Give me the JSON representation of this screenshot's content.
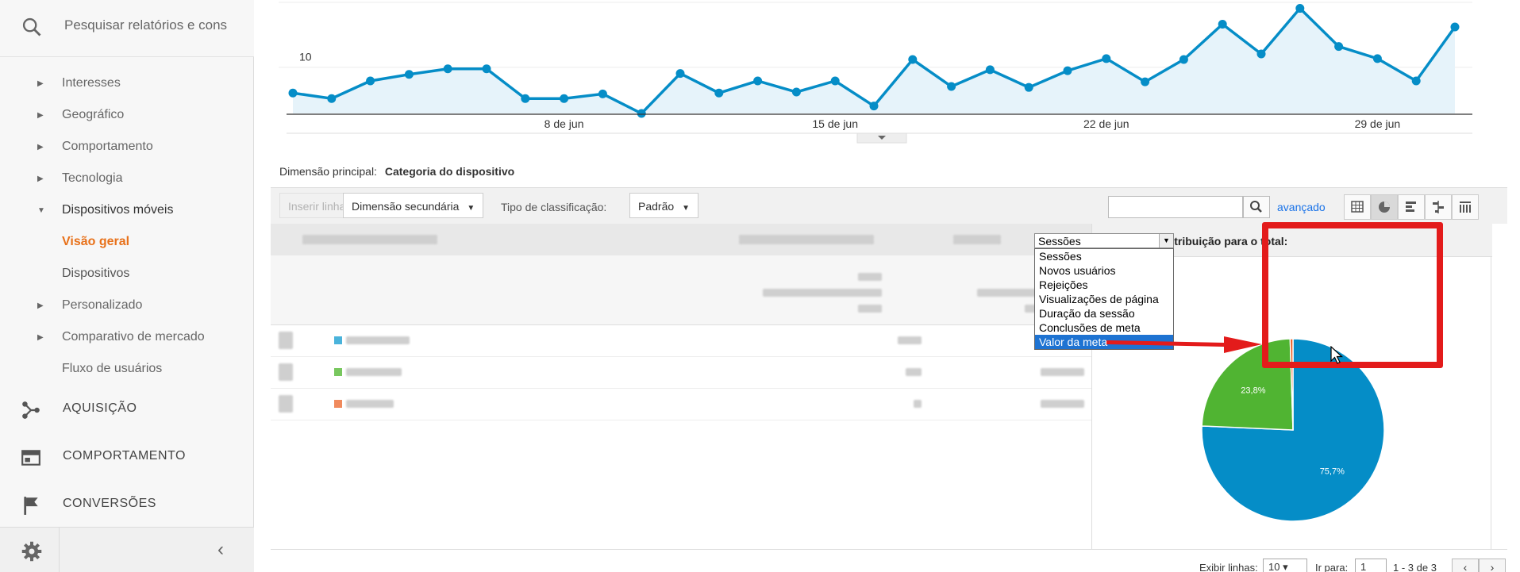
{
  "sidebar": {
    "search_placeholder": "Pesquisar relatórios e cons",
    "items": [
      {
        "label": "Interesses"
      },
      {
        "label": "Geográfico"
      },
      {
        "label": "Comportamento"
      },
      {
        "label": "Tecnologia"
      },
      {
        "label": "Dispositivos móveis"
      },
      {
        "label": "Visão geral"
      },
      {
        "label": "Dispositivos"
      },
      {
        "label": "Personalizado"
      },
      {
        "label": "Comparativo de mercado"
      },
      {
        "label": "Fluxo de usuários"
      }
    ],
    "sections": [
      {
        "label": "AQUISIÇÃO",
        "icon": "acquisition-icon"
      },
      {
        "label": "COMPORTAMENTO",
        "icon": "behavior-icon"
      },
      {
        "label": "CONVERSÕES",
        "icon": "flag-icon"
      }
    ]
  },
  "chart_data": {
    "type": "area",
    "y_tick": "10",
    "x_ticks": [
      "8 de jun",
      "15 de jun",
      "22 de jun",
      "29 de jun"
    ],
    "values": [
      7.2,
      6.6,
      8.5,
      9.2,
      9.8,
      9.8,
      6.6,
      6.6,
      7.1,
      5.0,
      9.3,
      7.2,
      8.5,
      7.3,
      8.5,
      5.8,
      10.8,
      7.9,
      9.7,
      7.8,
      9.6,
      10.9,
      8.4,
      10.8,
      14.6,
      11.4,
      16.3,
      12.2,
      10.9,
      8.5,
      14.3
    ],
    "ylim": [
      5.0,
      17.2
    ],
    "line_color": "#058dc7",
    "fill_color": "#e6f3fa"
  },
  "primary_dimension": {
    "label": "Dimensão principal:",
    "value": "Categoria do dispositivo"
  },
  "toolbar": {
    "insert_rows": "Inserir linhas",
    "secondary_dimension": "Dimensão secundária",
    "sort_type_label": "Tipo de classificação:",
    "sort_type_value": "Padrão",
    "advanced": "avançado",
    "view_icons": [
      "table-view-icon",
      "pie-view-icon",
      "performance-view-icon",
      "comparison-view-icon",
      "pivot-view-icon"
    ]
  },
  "pie": {
    "contribution_label": "Contribuição para o total:",
    "selected_metric": "Sessões",
    "options": [
      "Sessões",
      "Novos usuários",
      "Rejeições",
      "Visualizações de página",
      "Duração da sessão",
      "Conclusões de meta",
      "Valor da meta"
    ],
    "highlighted_option": 6,
    "slices": [
      {
        "pct": 75.7,
        "label": "75,7%",
        "color": "#058dc7"
      },
      {
        "pct": 23.8,
        "label": "23,8%",
        "color": "#50b432"
      },
      {
        "pct": 0.5,
        "label": "",
        "color": "#ed561b"
      }
    ]
  },
  "footer": {
    "rows_label": "Exibir linhas:",
    "rows_value": "10",
    "goto_label": "Ir para:",
    "goto_value": "1",
    "range": "1 - 3 de 3"
  },
  "annotation": {
    "highlight_color": "#e31b1b"
  }
}
